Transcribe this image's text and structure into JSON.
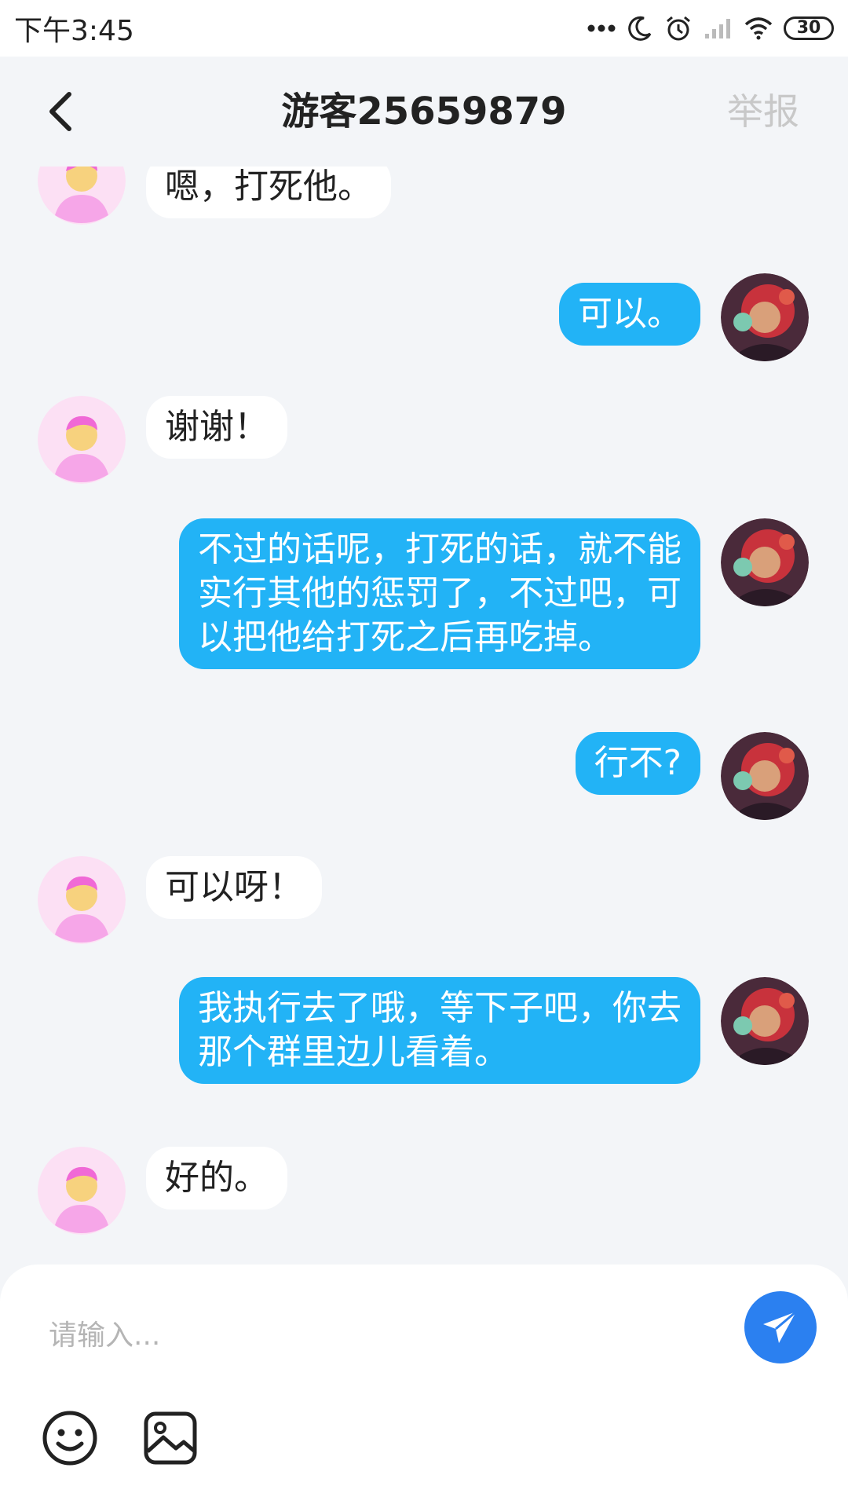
{
  "status_bar": {
    "time": "下午3:45",
    "battery": "30",
    "icons": [
      "more-dots-icon",
      "moon-icon",
      "alarm-icon",
      "signal-icon",
      "wifi-icon",
      "battery-icon"
    ]
  },
  "nav": {
    "back_icon": "chevron-left-icon",
    "title": "游客25659879",
    "report_label": "举报"
  },
  "colors": {
    "my_bubble": "#22b3f6",
    "their_bubble": "#ffffff",
    "send_button": "#2b80f0",
    "report_text": "#c8c8c8"
  },
  "messages": [
    {
      "sender": "other",
      "text": "嗯，打死他。"
    },
    {
      "sender": "me",
      "text": "可以。"
    },
    {
      "sender": "other",
      "text": "谢谢！"
    },
    {
      "sender": "me",
      "text": "不过的话呢，打死的话，就不能\n实行其他的惩罚了，不过吧，可\n以把他给打死之后再吃掉。"
    },
    {
      "sender": "me",
      "text": "行不?"
    },
    {
      "sender": "other",
      "text": "可以呀！"
    },
    {
      "sender": "me",
      "text": "我执行去了哦，等下子吧，你去\n那个群里边儿看着。"
    },
    {
      "sender": "other",
      "text": "好的。"
    }
  ],
  "input": {
    "placeholder": "请输入...",
    "value": "",
    "send_icon": "paper-plane-icon",
    "tools": [
      "emoji-icon",
      "image-icon"
    ]
  }
}
